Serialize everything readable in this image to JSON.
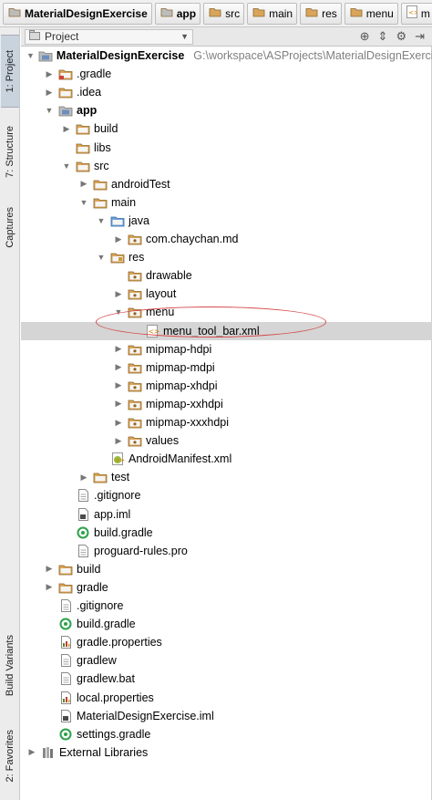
{
  "breadcrumb": {
    "items": [
      {
        "label": "MaterialDesignExercise",
        "bold": true,
        "icon": "project-folder-icon"
      },
      {
        "label": "app",
        "bold": true,
        "icon": "module-folder-icon"
      },
      {
        "label": "src",
        "bold": false,
        "icon": "folder-icon"
      },
      {
        "label": "main",
        "bold": false,
        "icon": "folder-icon"
      },
      {
        "label": "res",
        "bold": false,
        "icon": "res-folder-icon"
      },
      {
        "label": "menu",
        "bold": false,
        "icon": "folder-icon"
      },
      {
        "label": "m",
        "bold": false,
        "icon": "xml-file-icon"
      }
    ]
  },
  "panel": {
    "view_selector": "Project",
    "icons": [
      "target-icon",
      "collapse-icon",
      "settings-icon",
      "hide-icon"
    ]
  },
  "side_tabs": {
    "project": "1: Project",
    "structure": "7: Structure",
    "captures": "Captures",
    "build_variants": "Build Variants",
    "favorites": "2: Favorites"
  },
  "tree": [
    {
      "label": "MaterialDesignExercise",
      "bold": true,
      "path": "G:\\workspace\\ASProjects\\MaterialDesignExercise",
      "level": 0,
      "arrow": "down",
      "icon": "module"
    },
    {
      "label": ".gradle",
      "level": 1,
      "arrow": "right",
      "icon": "folder-red"
    },
    {
      "label": ".idea",
      "level": 1,
      "arrow": "right",
      "icon": "folder"
    },
    {
      "label": "app",
      "bold": true,
      "level": 1,
      "arrow": "down",
      "icon": "module"
    },
    {
      "label": "build",
      "level": 2,
      "arrow": "right",
      "icon": "folder"
    },
    {
      "label": "libs",
      "level": 2,
      "arrow": "none",
      "icon": "folder"
    },
    {
      "label": "src",
      "level": 2,
      "arrow": "down",
      "icon": "folder"
    },
    {
      "label": "androidTest",
      "level": 3,
      "arrow": "right",
      "icon": "folder"
    },
    {
      "label": "main",
      "level": 3,
      "arrow": "down",
      "icon": "folder"
    },
    {
      "label": "java",
      "level": 4,
      "arrow": "down",
      "icon": "folder-blue"
    },
    {
      "label": "com.chaychan.md",
      "level": 5,
      "arrow": "right",
      "icon": "package"
    },
    {
      "label": "res",
      "level": 4,
      "arrow": "down",
      "icon": "folder-res"
    },
    {
      "label": "drawable",
      "level": 5,
      "arrow": "none",
      "icon": "package"
    },
    {
      "label": "layout",
      "level": 5,
      "arrow": "right",
      "icon": "package"
    },
    {
      "label": "menu",
      "level": 5,
      "arrow": "down",
      "icon": "package"
    },
    {
      "label": "menu_tool_bar.xml",
      "level": 6,
      "arrow": "none",
      "icon": "xml",
      "selected": true
    },
    {
      "label": "mipmap-hdpi",
      "level": 5,
      "arrow": "right",
      "icon": "package"
    },
    {
      "label": "mipmap-mdpi",
      "level": 5,
      "arrow": "right",
      "icon": "package"
    },
    {
      "label": "mipmap-xhdpi",
      "level": 5,
      "arrow": "right",
      "icon": "package"
    },
    {
      "label": "mipmap-xxhdpi",
      "level": 5,
      "arrow": "right",
      "icon": "package"
    },
    {
      "label": "mipmap-xxxhdpi",
      "level": 5,
      "arrow": "right",
      "icon": "package"
    },
    {
      "label": "values",
      "level": 5,
      "arrow": "right",
      "icon": "package"
    },
    {
      "label": "AndroidManifest.xml",
      "level": 4,
      "arrow": "none",
      "icon": "manifest"
    },
    {
      "label": "test",
      "level": 3,
      "arrow": "right",
      "icon": "folder"
    },
    {
      "label": ".gitignore",
      "level": 2,
      "arrow": "none",
      "icon": "file"
    },
    {
      "label": "app.iml",
      "level": 2,
      "arrow": "none",
      "icon": "iml"
    },
    {
      "label": "build.gradle",
      "level": 2,
      "arrow": "none",
      "icon": "gradle"
    },
    {
      "label": "proguard-rules.pro",
      "level": 2,
      "arrow": "none",
      "icon": "file"
    },
    {
      "label": "build",
      "level": 1,
      "arrow": "right",
      "icon": "folder"
    },
    {
      "label": "gradle",
      "level": 1,
      "arrow": "right",
      "icon": "folder"
    },
    {
      "label": ".gitignore",
      "level": 1,
      "arrow": "none",
      "icon": "file"
    },
    {
      "label": "build.gradle",
      "level": 1,
      "arrow": "none",
      "icon": "gradle"
    },
    {
      "label": "gradle.properties",
      "level": 1,
      "arrow": "none",
      "icon": "properties"
    },
    {
      "label": "gradlew",
      "level": 1,
      "arrow": "none",
      "icon": "file"
    },
    {
      "label": "gradlew.bat",
      "level": 1,
      "arrow": "none",
      "icon": "file"
    },
    {
      "label": "local.properties",
      "level": 1,
      "arrow": "none",
      "icon": "properties"
    },
    {
      "label": "MaterialDesignExercise.iml",
      "level": 1,
      "arrow": "none",
      "icon": "iml"
    },
    {
      "label": "settings.gradle",
      "level": 1,
      "arrow": "none",
      "icon": "gradle"
    },
    {
      "label": "External Libraries",
      "level": 0,
      "arrow": "right",
      "icon": "libraries"
    }
  ],
  "colors": {
    "folder": "#d9a45b",
    "selection": "#d5d5d5",
    "annotation": "#d64a4a",
    "gradle_green": "#2ca14a"
  }
}
